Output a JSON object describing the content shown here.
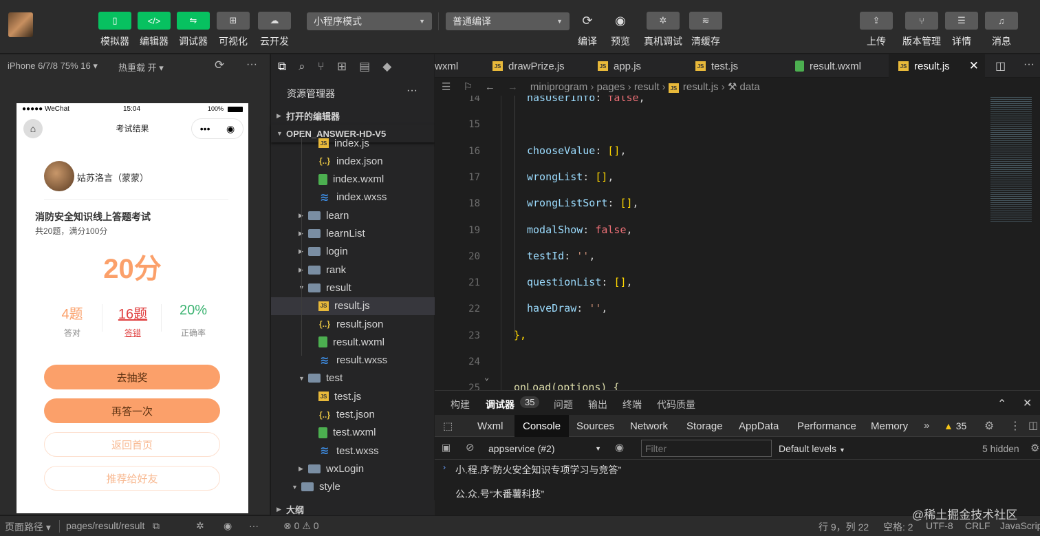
{
  "toolbar": {
    "left_buttons": [
      {
        "label": "模拟器",
        "icon": "phone-icon"
      },
      {
        "label": "编辑器",
        "icon": "code-icon"
      },
      {
        "label": "调试器",
        "icon": "debug-icon"
      },
      {
        "label": "可视化",
        "icon": "layout-icon"
      },
      {
        "label": "云开发",
        "icon": "cloud-icon"
      }
    ],
    "mode_select": "小程序模式",
    "compile_select": "普通编译",
    "mid_buttons": [
      {
        "label": "编译",
        "icon": "refresh-icon"
      },
      {
        "label": "预览",
        "icon": "eye-icon"
      },
      {
        "label": "真机调试",
        "icon": "bug-icon"
      },
      {
        "label": "清缓存",
        "icon": "layers-icon"
      }
    ],
    "right_buttons": [
      {
        "label": "上传",
        "icon": "upload-icon"
      },
      {
        "label": "版本管理",
        "icon": "branch-icon"
      },
      {
        "label": "详情",
        "icon": "menu-icon"
      },
      {
        "label": "消息",
        "icon": "bell-icon"
      }
    ]
  },
  "simulator": {
    "device": "iPhone 6/7/8 75% 16",
    "hot_reload": "热重载 开",
    "status_carrier": "●●●●● WeChat",
    "status_time": "15:04",
    "status_battery": "100%",
    "nav_title": "考试结果",
    "user_name": "姑苏洛言（蒙蒙）",
    "exam_title": "消防安全知识线上答题考试",
    "exam_sub": "共20题，满分100分",
    "score": "20分",
    "stats": [
      {
        "value": "4题",
        "label": "答对"
      },
      {
        "value": "16题",
        "label": "答错"
      },
      {
        "value": "20%",
        "label": "正确率"
      }
    ],
    "buttons": [
      "去抽奖",
      "再答一次",
      "返回首页",
      "推荐给好友"
    ]
  },
  "explorer": {
    "title": "资源管理器",
    "more": "···",
    "sec_open": "打开的编辑器",
    "sec_project": "OPEN_ANSWER-HD-V5",
    "sec_outline": "大纲",
    "items": [
      {
        "name": "index.js",
        "type": "js",
        "indent": 2
      },
      {
        "name": "index.json",
        "type": "json",
        "indent": 2
      },
      {
        "name": "index.wxml",
        "type": "wxml",
        "indent": 2
      },
      {
        "name": "index.wxss",
        "type": "wxss",
        "indent": 2
      },
      {
        "name": "learn",
        "type": "folder",
        "indent": 1,
        "arrow": "▶"
      },
      {
        "name": "learnList",
        "type": "folder",
        "indent": 1,
        "arrow": "▶"
      },
      {
        "name": "login",
        "type": "folder",
        "indent": 1,
        "arrow": "▶"
      },
      {
        "name": "rank",
        "type": "folder",
        "indent": 1,
        "arrow": "▶"
      },
      {
        "name": "result",
        "type": "folder",
        "indent": 1,
        "arrow": "▼"
      },
      {
        "name": "result.js",
        "type": "js",
        "indent": 2,
        "selected": true
      },
      {
        "name": "result.json",
        "type": "json",
        "indent": 2
      },
      {
        "name": "result.wxml",
        "type": "wxml",
        "indent": 2
      },
      {
        "name": "result.wxss",
        "type": "wxss",
        "indent": 2
      },
      {
        "name": "test",
        "type": "folder",
        "indent": 1,
        "arrow": "▼"
      },
      {
        "name": "test.js",
        "type": "js",
        "indent": 2
      },
      {
        "name": "test.json",
        "type": "json",
        "indent": 2
      },
      {
        "name": "test.wxml",
        "type": "wxml",
        "indent": 2
      },
      {
        "name": "test.wxss",
        "type": "wxss",
        "indent": 2
      },
      {
        "name": "wxLogin",
        "type": "folder",
        "indent": 1,
        "arrow": "▶"
      },
      {
        "name": "style",
        "type": "folder",
        "indent": 0,
        "arrow": "▼"
      }
    ]
  },
  "editor": {
    "tabs": [
      {
        "label": "wxml",
        "type": "none"
      },
      {
        "label": "drawPrize.js",
        "type": "js"
      },
      {
        "label": "app.js",
        "type": "js"
      },
      {
        "label": "test.js",
        "type": "js"
      },
      {
        "label": "result.wxml",
        "type": "wxml"
      },
      {
        "label": "result.js",
        "type": "js",
        "active": true
      }
    ],
    "breadcrumb": [
      "miniprogram",
      "pages",
      "result",
      "result.js",
      "data"
    ],
    "lines": [
      {
        "n": "14",
        "key": "hasUserInfo",
        "val": "false",
        "vt": "kw"
      },
      {
        "n": "15",
        "key": "",
        "val": "",
        "vt": ""
      },
      {
        "n": "16",
        "key": "chooseValue",
        "val": "[]",
        "vt": "br"
      },
      {
        "n": "17",
        "key": "wrongList",
        "val": "[]",
        "vt": "br"
      },
      {
        "n": "18",
        "key": "wrongListSort",
        "val": "[]",
        "vt": "br"
      },
      {
        "n": "19",
        "key": "modalShow",
        "val": "false",
        "vt": "kw"
      },
      {
        "n": "20",
        "key": "testId",
        "val": "''",
        "vt": "str"
      },
      {
        "n": "21",
        "key": "questionList",
        "val": "[]",
        "vt": "br"
      },
      {
        "n": "22",
        "key": "haveDraw",
        "val": "''",
        "vt": "str"
      },
      {
        "n": "23",
        "key": "},",
        "val": "",
        "vt": "raw"
      },
      {
        "n": "24",
        "key": "",
        "val": "",
        "vt": ""
      },
      {
        "n": "25",
        "key": "onLoad(options) {",
        "val": "",
        "vt": "fn"
      }
    ]
  },
  "panel": {
    "tabs": [
      "构建",
      "调试器",
      "问题",
      "输出",
      "终端",
      "代码质量"
    ],
    "debugger_badge": "35",
    "devtools_tabs": [
      "Wxml",
      "Console",
      "Sources",
      "Network",
      "Storage",
      "AppData",
      "Performance",
      "Memory"
    ],
    "warn_count": "35",
    "context": "appservice (#2)",
    "filter_placeholder": "Filter",
    "levels": "Default levels",
    "hidden": "5 hidden",
    "console_lines": [
      "小.程.序“防火安全知识专项学习与竞答”",
      "公.众.号“木番薯科技”"
    ]
  },
  "status": {
    "page_path_label": "页面路径",
    "page_path": "pages/result/result",
    "errors": "0",
    "warnings": "0",
    "position": "行 9，列 22",
    "spaces": "空格: 2",
    "encoding": "UTF-8",
    "eol": "CRLF",
    "language": "JavaScrip",
    "watermark": "@稀土掘金技术社区"
  },
  "colors": {
    "accent": "#07c160",
    "score": "#fba06a",
    "wrong": "#e04040",
    "rate": "#3cb371"
  }
}
